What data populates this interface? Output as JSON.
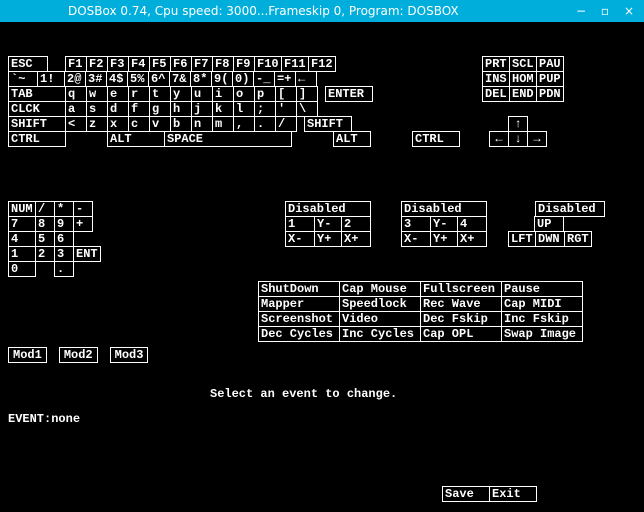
{
  "titlebar": {
    "title": "DOSBox 0.74, Cpu speed:    3000...Frameskip  0, Program:   DOSBOX"
  },
  "keyboard": {
    "row1": [
      "ESC",
      "F1",
      "F2",
      "F3",
      "F4",
      "F5",
      "F6",
      "F7",
      "F8",
      "F9",
      "F10",
      "F11",
      "F12"
    ],
    "row2": [
      "`~",
      "1!",
      "2@",
      "3#",
      "4$",
      "5%",
      "6^",
      "7&",
      "8*",
      "9(",
      "0)",
      "-_",
      "=+",
      "←"
    ],
    "row3": [
      "TAB",
      "q",
      "w",
      "e",
      "r",
      "t",
      "y",
      "u",
      "i",
      "o",
      "p",
      "[",
      "]",
      "ENTER"
    ],
    "row4": [
      "CLCK",
      "a",
      "s",
      "d",
      "f",
      "g",
      "h",
      "j",
      "k",
      "l",
      ";",
      "'",
      "\\"
    ],
    "row5": [
      "SHIFT",
      "<",
      "z",
      "x",
      "c",
      "v",
      "b",
      "n",
      "m",
      ",",
      ".",
      "/",
      "SHIFT"
    ],
    "row6": [
      "CTRL",
      "ALT",
      "SPACE",
      "ALT",
      "CTRL"
    ]
  },
  "nav": {
    "row1": [
      "PRT",
      "SCL",
      "PAU"
    ],
    "row2": [
      "INS",
      "HOM",
      "PUP"
    ],
    "row3": [
      "DEL",
      "END",
      "PDN"
    ],
    "arrows": {
      "up": "↑",
      "left": "←",
      "down": "↓",
      "right": "→"
    }
  },
  "numpad": {
    "row1": [
      "NUM",
      "/",
      "*",
      "-"
    ],
    "row2": [
      "7",
      "8",
      "9",
      "+"
    ],
    "row3": [
      "4",
      "5",
      "6"
    ],
    "row4": [
      "1",
      "2",
      "3",
      "ENT"
    ],
    "row5": [
      "0",
      ".",
      ""
    ]
  },
  "disabled_blocks": [
    {
      "title": "Disabled",
      "rows": [
        [
          "1",
          "Y-",
          "2"
        ],
        [
          "X-",
          "Y+",
          "X+"
        ]
      ]
    },
    {
      "title": "Disabled",
      "rows": [
        [
          "3",
          "Y-",
          "4"
        ],
        [
          "X-",
          "Y+",
          "X+"
        ]
      ]
    }
  ],
  "disabled_right": {
    "title": "Disabled",
    "rows": [
      [
        "UP"
      ],
      [
        "LFT",
        "DWN",
        "RGT"
      ]
    ]
  },
  "actions": [
    [
      "ShutDown",
      "Cap Mouse",
      "Fullscreen",
      "Pause"
    ],
    [
      "Mapper",
      "Speedlock",
      "Rec Wave",
      "Cap MIDI"
    ],
    [
      "Screenshot",
      "Video",
      "Dec Fskip",
      "Inc Fskip"
    ],
    [
      "Dec Cycles",
      "Inc Cycles",
      "Cap OPL",
      "Swap Image"
    ]
  ],
  "mods": [
    "Mod1",
    "Mod2",
    "Mod3"
  ],
  "message": "Select an event to change.",
  "event_label": "EVENT:",
  "event_value": "none",
  "buttons": {
    "save": "Save",
    "exit": "Exit"
  }
}
